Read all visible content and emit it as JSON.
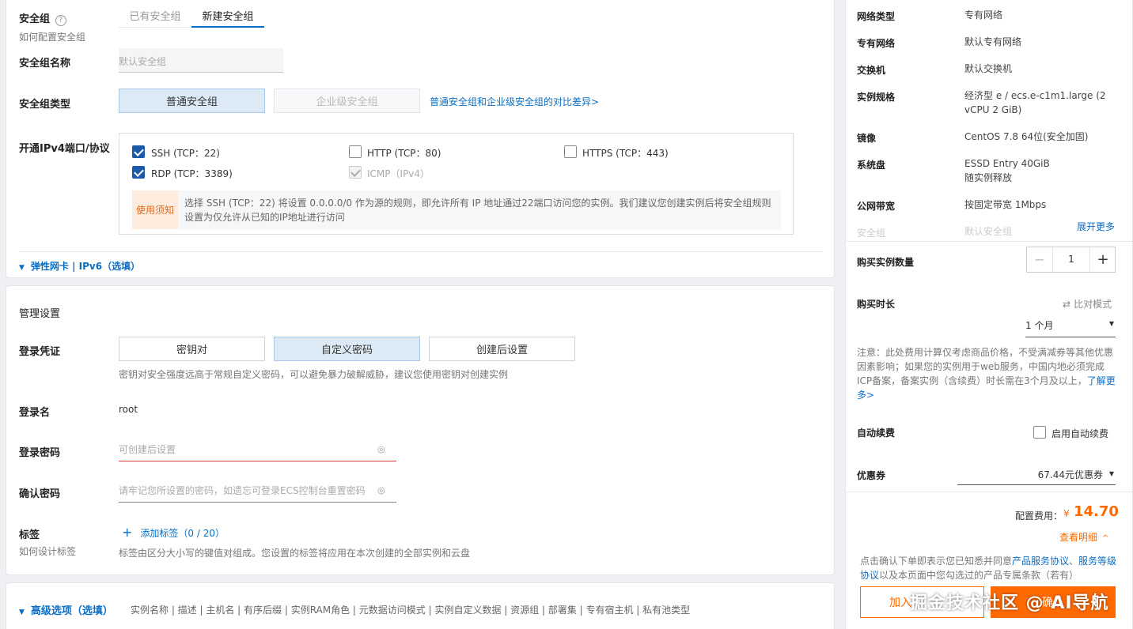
{
  "security_group": {
    "label": "安全组",
    "help_link": "如何配置安全组",
    "tabs": [
      "已有安全组",
      "新建安全组"
    ],
    "name_label": "安全组名称",
    "name_placeholder": "默认安全组",
    "type_label": "安全组类型",
    "type_options": [
      "普通安全组",
      "企业级安全组"
    ],
    "compare_link": "普通安全组和企业级安全组的对比差异>",
    "ports_label": "开通IPv4端口/协议",
    "ports": [
      {
        "label": "SSH (TCP：22)",
        "checked": true
      },
      {
        "label": "HTTP (TCP：80)",
        "checked": false
      },
      {
        "label": "HTTPS (TCP：443)",
        "checked": false
      },
      {
        "label": "RDP (TCP：3389)",
        "checked": true
      },
      {
        "label": "ICMP（IPv4）",
        "checked": true,
        "disabled": true
      }
    ],
    "notice_tag": "使用须知",
    "notice_text": "选择 SSH (TCP：22) 将设置 0.0.0.0/0 作为源的规则，即允许所有 IP 地址通过22端口访问您的实例。我们建议您创建实例后将安全组规则设置为仅允许从已知的IP地址进行访问",
    "eni_toggle": "弹性网卡 | IPv6（选填）"
  },
  "management": {
    "title": "管理设置",
    "credential_label": "登录凭证",
    "credential_options": [
      "密钥对",
      "自定义密码",
      "创建后设置"
    ],
    "credential_hint": "密钥对安全强度远高于常规自定义密码，可以避免暴力破解威胁，建议您使用密钥对创建实例",
    "login_name_label": "登录名",
    "login_name_value": "root",
    "password_label": "登录密码",
    "password_placeholder": "可创建后设置",
    "confirm_label": "确认密码",
    "confirm_placeholder": "请牢记您所设置的密码，如遗忘可登录ECS控制台重置密码",
    "tags_label": "标签",
    "tags_help": "如何设计标签",
    "add_tag": "添加标签（0 / 20）",
    "tags_hint": "标签由区分大小写的键值对组成。您设置的标签将应用在本次创建的全部实例和云盘"
  },
  "advanced": {
    "title": "高级选项（选填）",
    "items": "实例名称 | 描述 | 主机名 | 有序后缀 | 实例RAM角色 | 元数据访问模式 | 实例自定义数据 | 资源组 | 部署集 | 专有宿主机 | 私有池类型"
  },
  "summary": {
    "rows": [
      {
        "k": "网络类型",
        "v": "专有网络"
      },
      {
        "k": "专有网络",
        "v": "默认专有网络"
      },
      {
        "k": "交换机",
        "v": "默认交换机"
      },
      {
        "k": "实例规格",
        "v": "经济型 e / ecs.e-c1m1.large (2 vCPU 2 GiB)"
      },
      {
        "k": "镜像",
        "v": "CentOS 7.8 64位(安全加固)"
      },
      {
        "k": "系统盘",
        "v": "ESSD Entry 40GiB\n随实例释放"
      },
      {
        "k": "公网带宽",
        "v": "按固定带宽 1Mbps"
      },
      {
        "k": "安全组",
        "v": "默认安全组"
      }
    ],
    "expand_more": "展开更多",
    "quantity_label": "购买实例数量",
    "quantity_value": "1",
    "duration_label": "购买时长",
    "compare_mode": "比对模式",
    "duration_value": "1 个月",
    "note": "注意：此处费用计算仅考虑商品价格，不受满减券等其他优惠因素影响；如果您的实例用于web服务，中国内地必须完成ICP备案，备案实例（含续费）时长需在3个月及以上，",
    "note_link": "了解更多>",
    "auto_renew_label": "自动续费",
    "auto_renew_option": "启用自动续费",
    "coupon_label": "优惠券",
    "coupon_value": "67.44元优惠券",
    "fee_label": "配置费用：",
    "fee_currency": "¥",
    "fee_value": "14.70",
    "view_detail": "查看明细",
    "agree_prefix": "点击确认下单即表示您已知悉并同意",
    "agree_link1": "产品服务协议",
    "agree_sep": "、",
    "agree_link2": "服务等级协议",
    "agree_suffix": "以及本页面中您勾选过的产品专属条款（若有）",
    "add_cart": "加入",
    "confirm_btn": "确认"
  },
  "watermark": "掘金技术社区 @ AI导航",
  "colors": {
    "accent": "#0b6ec4",
    "price": "#ff6a00",
    "selected_bg": "#dceaf6"
  }
}
